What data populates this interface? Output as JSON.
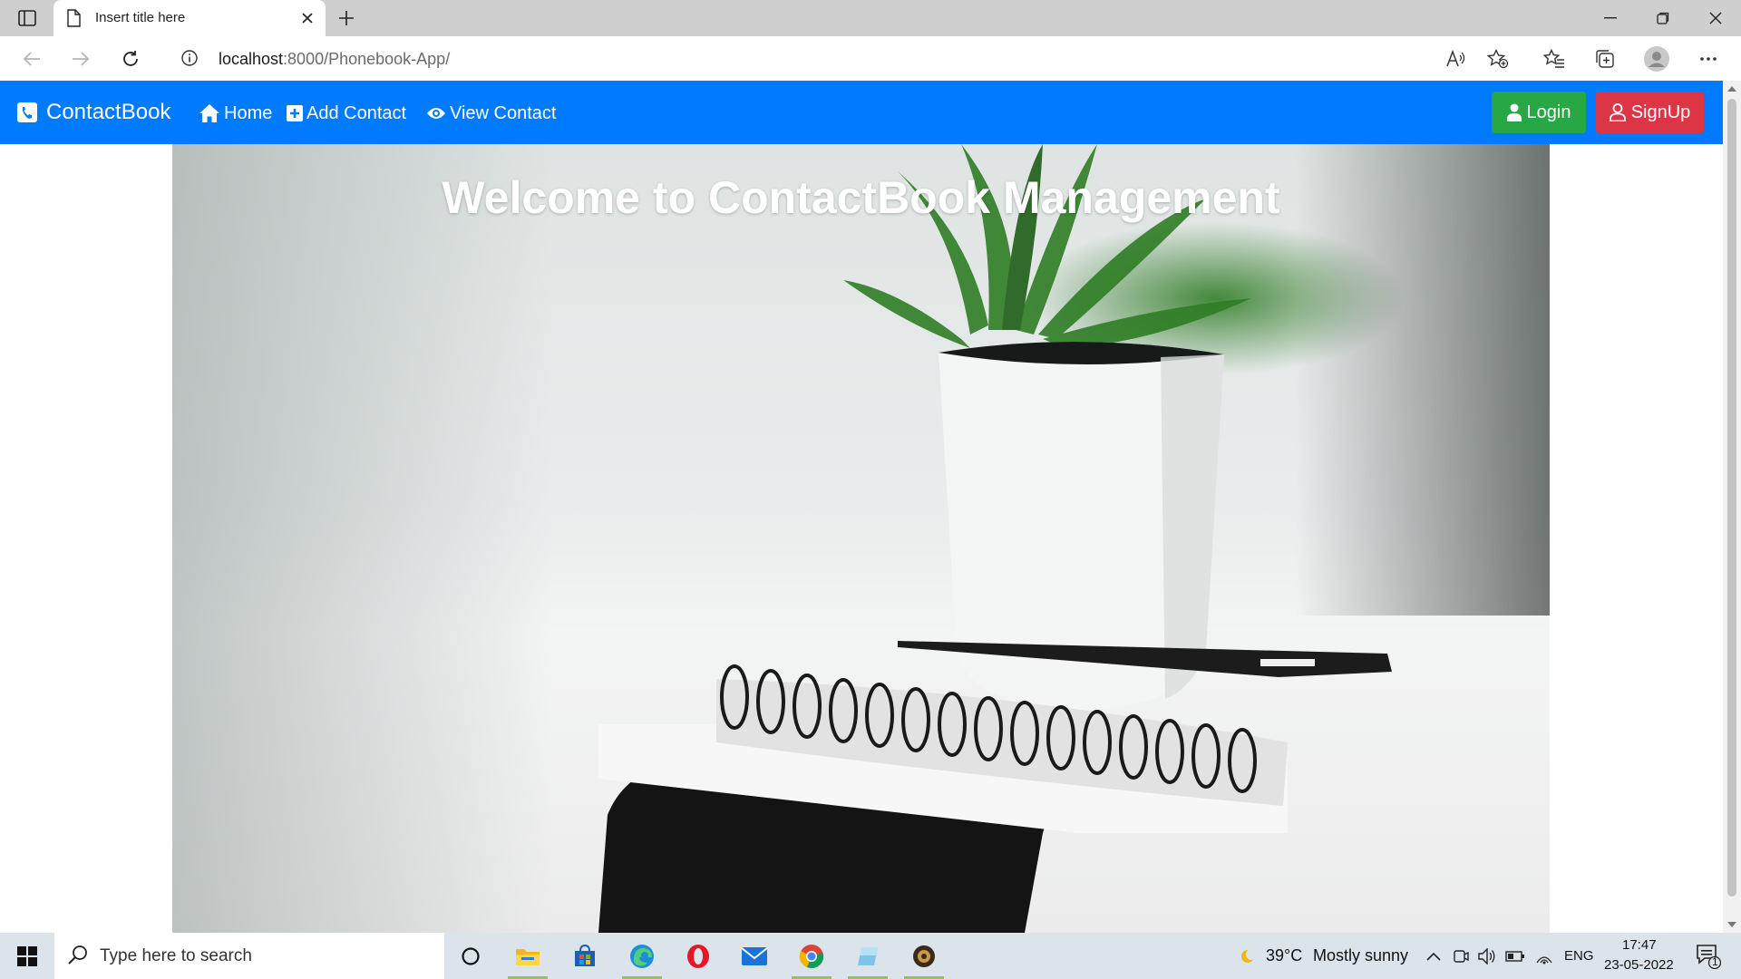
{
  "browser": {
    "tab_title": "Insert title here",
    "url_host": "localhost",
    "url_rest": ":8000/Phonebook-App/"
  },
  "navbar": {
    "brand": "ContactBook",
    "links": [
      {
        "label": "Home",
        "icon": "home-icon"
      },
      {
        "label": "Add Contact",
        "icon": "plus-square-icon"
      },
      {
        "label": "View Contact",
        "icon": "eye-icon"
      }
    ],
    "login_label": "Login",
    "signup_label": "SignUp",
    "colors": {
      "bar": "#007bff",
      "login": "#28a745",
      "signup": "#dc3545"
    }
  },
  "hero": {
    "title": "Welcome to ContactBook Management"
  },
  "taskbar": {
    "search_placeholder": "Type here to search",
    "apps": [
      "cortana-icon",
      "file-explorer-icon",
      "store-icon",
      "edge-icon",
      "opera-icon",
      "mail-icon",
      "chrome-icon",
      "notepad-icon",
      "app-icon"
    ],
    "weather_temp": "39°C",
    "weather_desc": "Mostly sunny",
    "language": "ENG",
    "time": "17:47",
    "date": "23-05-2022",
    "notification_count": "1"
  }
}
